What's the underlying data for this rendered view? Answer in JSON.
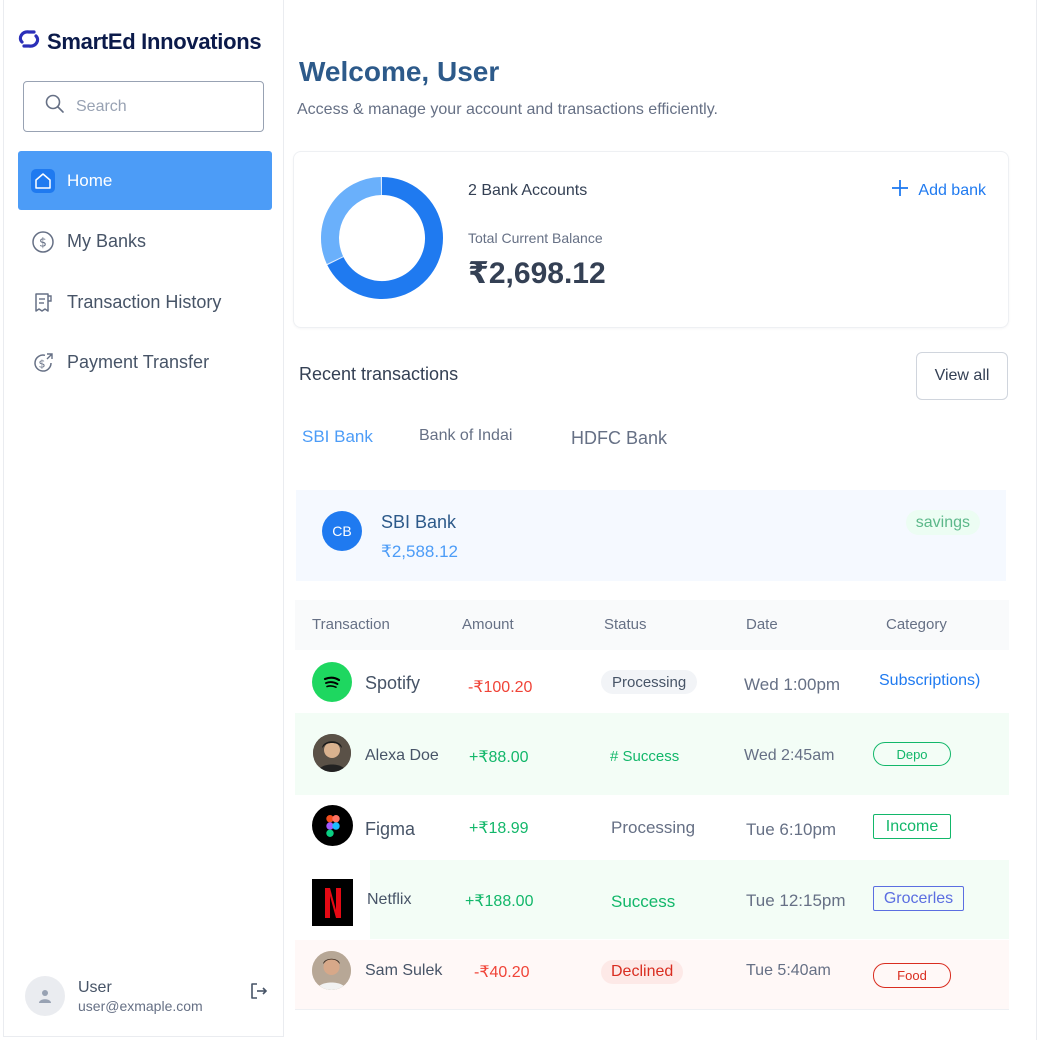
{
  "app": {
    "brand": "SmartEd Innovations"
  },
  "sidebar": {
    "search_placeholder": "Search",
    "items": [
      {
        "label": "Home",
        "icon": "home-icon"
      },
      {
        "label": "My Banks",
        "icon": "dollar-icon"
      },
      {
        "label": "Transaction History",
        "icon": "receipt-icon"
      },
      {
        "label": "Payment Transfer",
        "icon": "money-send-icon"
      }
    ],
    "user": {
      "name": "User",
      "email": "user@exmaple.com"
    }
  },
  "header": {
    "title": "Welcome, User",
    "subtitle": "Access & manage your account and transactions efficiently."
  },
  "balance": {
    "bank_count": "2 Bank Accounts",
    "total_label": "Total Current Balance",
    "total_value": "₹2,698.12",
    "add_bank": "Add bank",
    "donut_shares": [
      0.68,
      0.32
    ]
  },
  "recent": {
    "title": "Recent transactions",
    "view_all": "View all",
    "tabs": [
      "SBI Bank",
      "Bank of Indai",
      "HDFC Bank"
    ],
    "active_bank": {
      "initials": "CB",
      "name": "SBI Bank",
      "balance": "₹2,588.12",
      "type": "savings"
    },
    "columns": [
      "Transaction",
      "Amount",
      "Status",
      "Date",
      "Category"
    ],
    "rows": [
      {
        "name": "Spotify",
        "amount": "-₹100.20",
        "status": "Processing",
        "date": "Wed 1:00pm",
        "category": "Subscriptions)"
      },
      {
        "name": "Alexa Doe",
        "amount": "+₹88.00",
        "status": "# Success",
        "date": "Wed 2:45am",
        "category": "Depo"
      },
      {
        "name": "Figma",
        "amount": "+₹18.99",
        "status": "Processing",
        "date": "Tue 6:10pm",
        "category": "Income"
      },
      {
        "name": "Netflix",
        "amount": "+₹188.00",
        "status": "Success",
        "date": "Tue 12:15pm",
        "category": "Grocerles"
      },
      {
        "name": "Sam Sulek",
        "amount": "-₹40.20",
        "status": "Declined",
        "date": "Tue 5:40am",
        "category": "Food"
      }
    ]
  },
  "colors": {
    "accent": "#4c9cf7",
    "brand": "#0b1a4a",
    "positive": "#12b76a",
    "negative": "#f04438"
  }
}
